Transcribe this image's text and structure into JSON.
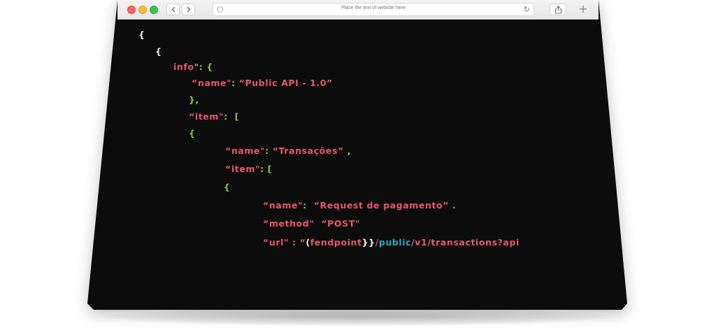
{
  "browser": {
    "address_placeholder": "Place the text of website here",
    "back_icon": "chevron-left-icon",
    "forward_icon": "chevron-right-icon",
    "reload_icon": "reload-icon",
    "share_icon": "share-icon",
    "new_tab_icon": "plus-icon",
    "window_controls": [
      "close",
      "minimize",
      "zoom"
    ]
  },
  "colors": {
    "key_string": "#e8586c",
    "punctuation": "#8fc24a",
    "brace": "#f2f2f2",
    "highlight": "#2fa8c6",
    "background": "#0c0c0c"
  },
  "code": {
    "l1": "{",
    "l2": "{",
    "l3_key": "info",
    "l3_rest": "\": {",
    "l4_key": "“name\"",
    "l4_sep": ": ",
    "l4_val": "“Public API - 1.0”",
    "l5": "},",
    "l6_key": "“item\"",
    "l6_rest": ":  [",
    "l7": "{",
    "l8_key": "“name\"",
    "l8_sep": ": ",
    "l8_val": "“Transações”",
    "l8_rest": " ,",
    "l9_key": "“item\"",
    "l9_rest": ": [",
    "l10": "{",
    "l11_key": "“name\"",
    "l11_sep": ":  ",
    "l11_val": "“Request de pagamento”",
    "l11_rest": " .",
    "l12_key": "“method\"",
    "l12_sep": "  ",
    "l12_val": "“POST\"",
    "l13_key": "“url\"",
    "l13_sep": " : “",
    "l13_brace_open": "(",
    "l13_endpoint": "fendpoint",
    "l13_brace_close": "}}",
    "l13_slash1": "/",
    "l13_public": "public",
    "l13_path": "/v1/transactions?api"
  }
}
